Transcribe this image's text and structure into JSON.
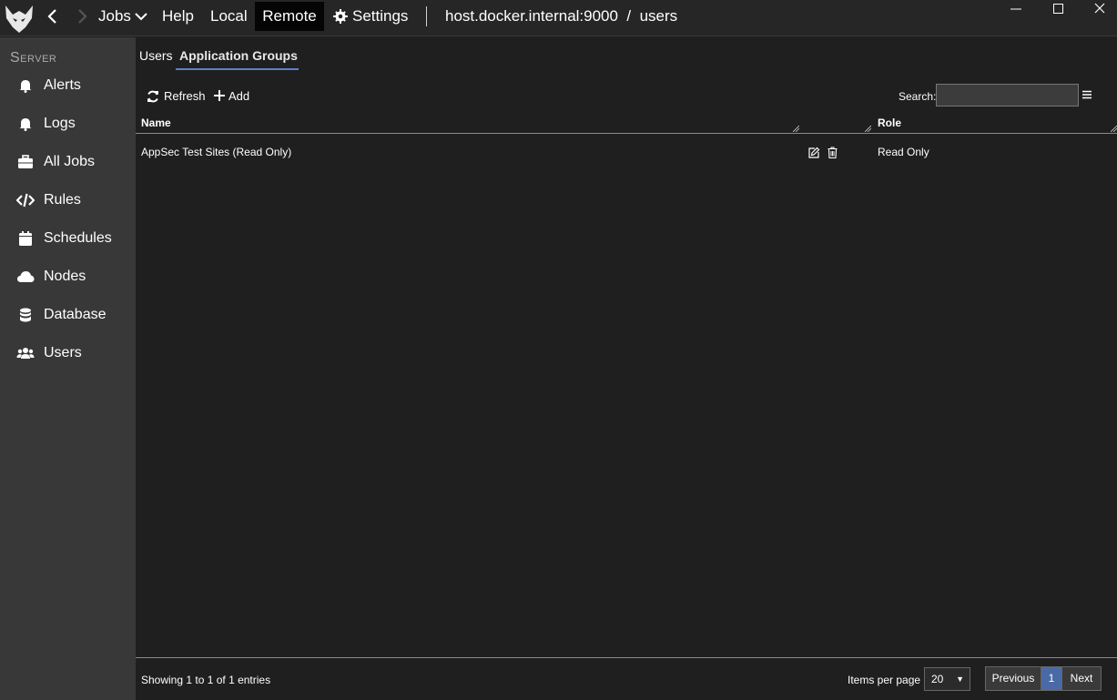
{
  "window": {
    "back_icon": "chevron-left-icon",
    "forward_icon": "chevron-right-icon",
    "logo_icon": "wolf-logo-icon"
  },
  "menu": {
    "jobs": "Jobs",
    "help": "Help",
    "local": "Local",
    "remote": "Remote",
    "settings": "Settings",
    "address": "host.docker.internal:9000  /  users"
  },
  "sidebar": {
    "title": "Server",
    "items": [
      {
        "label": "Alerts",
        "icon": "bell-icon"
      },
      {
        "label": "Logs",
        "icon": "bell-icon"
      },
      {
        "label": "All Jobs",
        "icon": "briefcase-icon"
      },
      {
        "label": "Rules",
        "icon": "code-icon"
      },
      {
        "label": "Schedules",
        "icon": "calendar-icon"
      },
      {
        "label": "Nodes",
        "icon": "cloud-icon"
      },
      {
        "label": "Database",
        "icon": "database-icon"
      },
      {
        "label": "Users",
        "icon": "users-icon"
      }
    ]
  },
  "tabs": {
    "users": "Users",
    "groups": "Application Groups"
  },
  "toolbar": {
    "refresh": "Refresh",
    "add": "Add",
    "search_label": "Search:",
    "search_value": ""
  },
  "table": {
    "columns": {
      "name": "Name",
      "role": "Role"
    },
    "rows": [
      {
        "name": "AppSec Test Sites (Read Only)",
        "role": "Read Only"
      }
    ]
  },
  "footer": {
    "showing": "Showing 1 to 1 of 1 entries",
    "items_per_page_label": "Items per page",
    "items_per_page": "20",
    "previous": "Previous",
    "page": "1",
    "next": "Next"
  },
  "colors": {
    "active_tab_underline": "#5a82c8",
    "active_page": "#4a6aa5",
    "sidebar_bg": "#383838",
    "main_bg": "#1f1f1f"
  }
}
